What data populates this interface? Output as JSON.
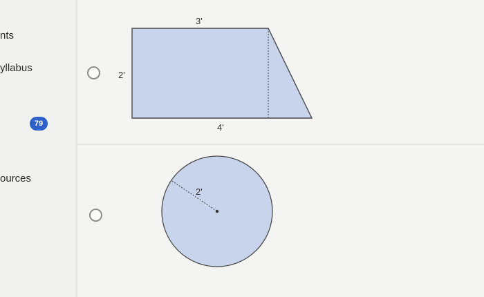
{
  "sidebar": {
    "items": [
      {
        "label": "nts"
      },
      {
        "label": "yllabus"
      },
      {
        "label": "ources"
      }
    ],
    "badge": "79"
  },
  "question": {
    "options": [
      {
        "shape": "trapezoid",
        "labels": {
          "top": "3'",
          "side": "2'",
          "bottom": "4'"
        }
      },
      {
        "shape": "circle",
        "labels": {
          "radius": "2'"
        }
      }
    ]
  },
  "colors": {
    "shape_fill": "#c7d4ec",
    "shape_stroke": "#4a4a4a",
    "badge": "#2d60c8"
  }
}
